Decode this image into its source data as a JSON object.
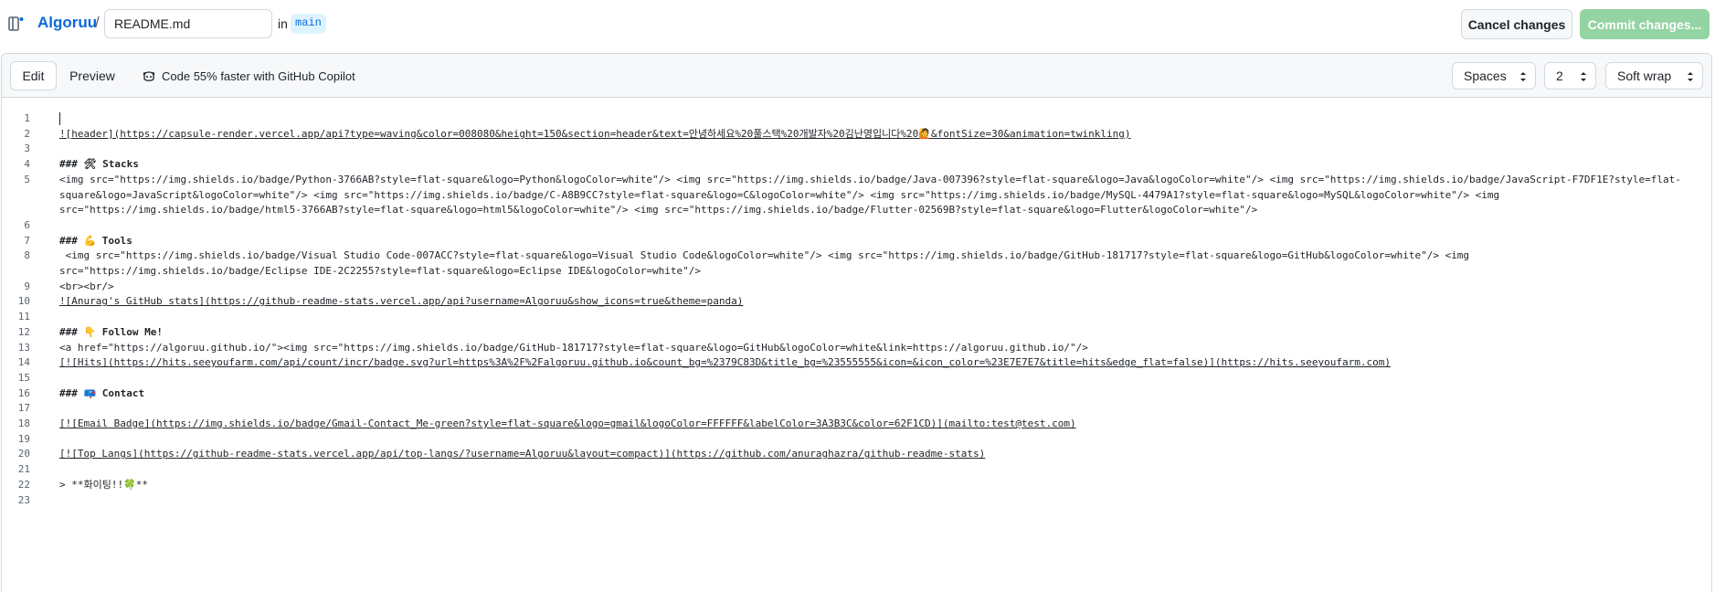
{
  "header": {
    "repo_name": "Algoruu",
    "separator": "/",
    "file_name_value": "README.md",
    "in_label": "in",
    "branch": "main",
    "cancel_label": "Cancel changes",
    "commit_label": "Commit changes..."
  },
  "toolbar": {
    "edit_tab": "Edit",
    "preview_tab": "Preview",
    "copilot_promo": "Code 55% faster with GitHub Copilot",
    "indent_mode": "Spaces",
    "indent_size": "2",
    "wrap_mode": "Soft wrap"
  },
  "editor": {
    "lines": [
      {
        "n": "1",
        "t": ""
      },
      {
        "n": "2",
        "t": "![header](https://capsule-render.vercel.app/api?type=waving&color=008080&height=150&section=header&text=안녕하세요%20풀스택%20개발자%20김난영입니다%20🙋&fontSize=30&animation=twinkling)"
      },
      {
        "n": "3",
        "t": ""
      },
      {
        "n": "4",
        "t": "### 🛠 Stacks"
      },
      {
        "n": "5",
        "t": "<img src=\"https://img.shields.io/badge/Python-3766AB?style=flat-square&logo=Python&logoColor=white\"/> <img src=\"https://img.shields.io/badge/Java-007396?style=flat-square&logo=Java&logoColor=white\"/> <img src=\"https://img.shields.io/badge/JavaScript-F7DF1E?style=flat-"
      },
      {
        "n": "",
        "t": "square&logo=JavaScript&logoColor=white\"/> <img src=\"https://img.shields.io/badge/C-A8B9CC?style=flat-square&logo=C&logoColor=white\"/> <img src=\"https://img.shields.io/badge/MySQL-4479A1?style=flat-square&logo=MySQL&logoColor=white\"/> <img"
      },
      {
        "n": "",
        "t": "src=\"https://img.shields.io/badge/html5-3766AB?style=flat-square&logo=html5&logoColor=white\"/> <img src=\"https://img.shields.io/badge/Flutter-02569B?style=flat-square&logo=Flutter&logoColor=white\"/>"
      },
      {
        "n": "6",
        "t": ""
      },
      {
        "n": "7",
        "t": "### 💪 Tools"
      },
      {
        "n": "8",
        "t": " <img src=\"https://img.shields.io/badge/Visual Studio Code-007ACC?style=flat-square&logo=Visual Studio Code&logoColor=white\"/> <img src=\"https://img.shields.io/badge/GitHub-181717?style=flat-square&logo=GitHub&logoColor=white\"/> <img"
      },
      {
        "n": "",
        "t": "src=\"https://img.shields.io/badge/Eclipse IDE-2C2255?style=flat-square&logo=Eclipse IDE&logoColor=white\"/>"
      },
      {
        "n": "9",
        "t": "<br><br/>"
      },
      {
        "n": "10",
        "t": "![Anurag's GitHub stats](https://github-readme-stats.vercel.app/api?username=Algoruu&show_icons=true&theme=panda)"
      },
      {
        "n": "11",
        "t": ""
      },
      {
        "n": "12",
        "t": "### 👇 Follow Me!"
      },
      {
        "n": "13",
        "t": "<a href=\"https://algoruu.github.io/\"><img src=\"https://img.shields.io/badge/GitHub-181717?style=flat-square&logo=GitHub&logoColor=white&link=https://algoruu.github.io/\"/>"
      },
      {
        "n": "14",
        "t": "[![Hits](https://hits.seeyoufarm.com/api/count/incr/badge.svg?url=https%3A%2F%2Falgoruu.github.io&count_bg=%2379C83D&title_bg=%23555555&icon=&icon_color=%23E7E7E7&title=hits&edge_flat=false)](https://hits.seeyoufarm.com)"
      },
      {
        "n": "15",
        "t": ""
      },
      {
        "n": "16",
        "t": "### 📪 Contact"
      },
      {
        "n": "17",
        "t": ""
      },
      {
        "n": "18",
        "t": "[![Email Badge](https://img.shields.io/badge/Gmail-Contact_Me-green?style=flat-square&logo=gmail&logoColor=FFFFFF&labelColor=3A3B3C&color=62F1CD)](mailto:test@test.com)"
      },
      {
        "n": "19",
        "t": ""
      },
      {
        "n": "20",
        "t": "[![Top Langs](https://github-readme-stats.vercel.app/api/top-langs/?username=Algoruu&layout=compact)](https://github.com/anuraghazra/github-readme-stats)"
      },
      {
        "n": "21",
        "t": ""
      },
      {
        "n": "22",
        "t": "> **화이팅!!🍀**"
      },
      {
        "n": "23",
        "t": ""
      }
    ]
  }
}
